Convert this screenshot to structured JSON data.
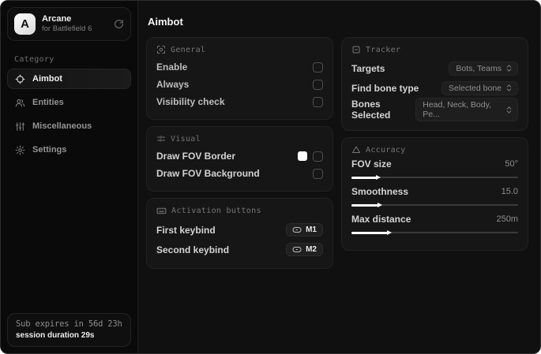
{
  "app": {
    "logo_letter": "A",
    "name": "Arcane",
    "subtitle": "for Battlefield 6"
  },
  "sidebar": {
    "category_label": "Category",
    "items": [
      {
        "label": "Aimbot",
        "icon": "crosshair-icon",
        "active": true
      },
      {
        "label": "Entities",
        "icon": "users-icon",
        "active": false
      },
      {
        "label": "Miscellaneous",
        "icon": "sliders-vertical-icon",
        "active": false
      },
      {
        "label": "Settings",
        "icon": "gear-icon",
        "active": false
      }
    ],
    "footer": {
      "sub_expires": "Sub expires in 56d 23h",
      "session_duration": "session duration 29s"
    }
  },
  "main": {
    "title": "Aimbot",
    "cards": {
      "general": {
        "title": "General",
        "icon": "focus-icon",
        "rows": [
          {
            "label": "Enable",
            "checked": false
          },
          {
            "label": "Always",
            "checked": false
          },
          {
            "label": "Visibility check",
            "checked": false
          }
        ]
      },
      "visual": {
        "title": "Visual",
        "icon": "sliders-horizontal-icon",
        "rows": [
          {
            "label": "Draw FOV Border",
            "checked": false,
            "swatch_color": "#ffffff"
          },
          {
            "label": "Draw FOV Background",
            "checked": false
          }
        ]
      },
      "activation": {
        "title": "Activation buttons",
        "icon": "keyboard-icon",
        "rows": [
          {
            "label": "First keybind",
            "key": "M1"
          },
          {
            "label": "Second keybind",
            "key": "M2"
          }
        ]
      },
      "tracker": {
        "title": "Tracker",
        "icon": "box-minus-icon",
        "rows": [
          {
            "label": "Targets",
            "value": "Bots, Teams"
          },
          {
            "label": "Find bone type",
            "value": "Selected bone"
          },
          {
            "label": "Bones Selected",
            "value": "Head, Neck, Body, Pe..."
          }
        ]
      },
      "accuracy": {
        "title": "Accuracy",
        "icon": "triangle-icon",
        "sliders": [
          {
            "label": "FOV size",
            "value": "50°",
            "percent": 15
          },
          {
            "label": "Smoothness",
            "value": "15.0",
            "percent": 16
          },
          {
            "label": "Max distance",
            "value": "250m",
            "percent": 22
          }
        ]
      }
    }
  },
  "colors": {
    "fov_border_swatch": "#ffffff",
    "background": "#101010",
    "sidebar_background": "#0a0a0a",
    "card_background": "#161616",
    "accent_text": "#f5f5f5"
  }
}
